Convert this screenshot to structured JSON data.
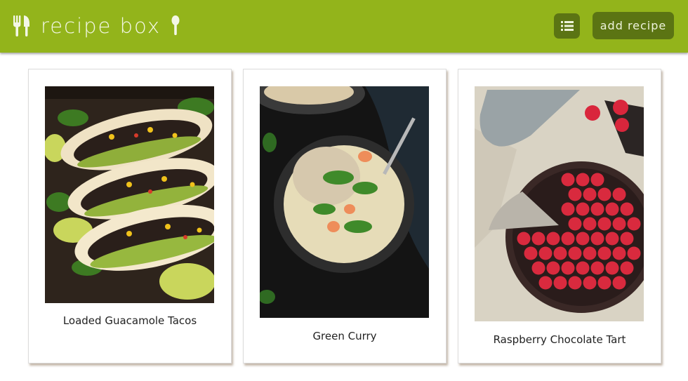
{
  "app": {
    "title": "recipe box",
    "logo_left_icon": "fork-knife-icon",
    "logo_right_icon": "spoon-icon",
    "brand_color": "#93b41b",
    "button_color": "#5b7413"
  },
  "toolbar": {
    "list_icon": "list-icon",
    "add_label": "add recipe"
  },
  "recipes": [
    {
      "name": "Loaded Guacamole Tacos",
      "image": "tacos-photo"
    },
    {
      "name": "Green Curry",
      "image": "green-curry-photo"
    },
    {
      "name": "Raspberry Chocolate Tart",
      "image": "raspberry-tart-photo"
    }
  ]
}
